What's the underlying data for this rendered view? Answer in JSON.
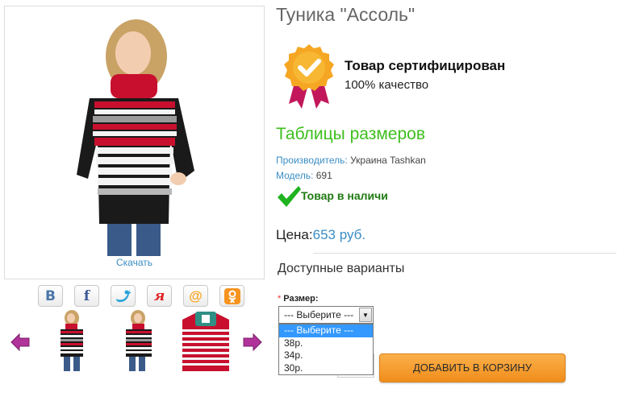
{
  "product": {
    "title": "Туника \"Ассоль\"",
    "download_label": "Скачать"
  },
  "certificate": {
    "title": "Товар сертифицирован",
    "subtitle": "100% качество",
    "badge_color": "#f5a623",
    "ribbon_color": "#c2185b"
  },
  "size_tables_link": "Таблицы размеров",
  "manufacturer": {
    "label": "Производитель:",
    "value": " Украина Tashkan"
  },
  "model": {
    "label": "Модель:",
    "value": " 691"
  },
  "stock": {
    "text": "Товар в наличи",
    "icon": "checkmark-icon",
    "color": "#1f7a12"
  },
  "price": {
    "label": "Цена:",
    "value": "653 руб."
  },
  "variants": {
    "title": "Доступные варианты",
    "size_required_marker": "*",
    "size_label": "Размер:",
    "selected": "--- Выберите ---",
    "options": [
      "--- Выберите ---",
      "38р.",
      "34р.",
      "30р."
    ]
  },
  "cart_button": "ДОБАВИТЬ В КОРЗИНУ",
  "social": [
    {
      "name": "vk-icon",
      "glyph": "B",
      "color": "#4a76a8"
    },
    {
      "name": "facebook-icon",
      "glyph": "f",
      "color": "#3b5998"
    },
    {
      "name": "twitter-icon",
      "glyph": "🐦",
      "color": "#1da1f2"
    },
    {
      "name": "yaru-icon",
      "glyph": "я",
      "color": "#e02020"
    },
    {
      "name": "mailru-icon",
      "glyph": "@",
      "color": "#f5a623"
    },
    {
      "name": "odnoklassniki-icon",
      "glyph": "ок",
      "color": "#f7931e"
    }
  ],
  "colors": {
    "accent_green": "#3dbf1d",
    "link_blue": "#3a8dc4",
    "arrow_purple": "#b0339a"
  }
}
